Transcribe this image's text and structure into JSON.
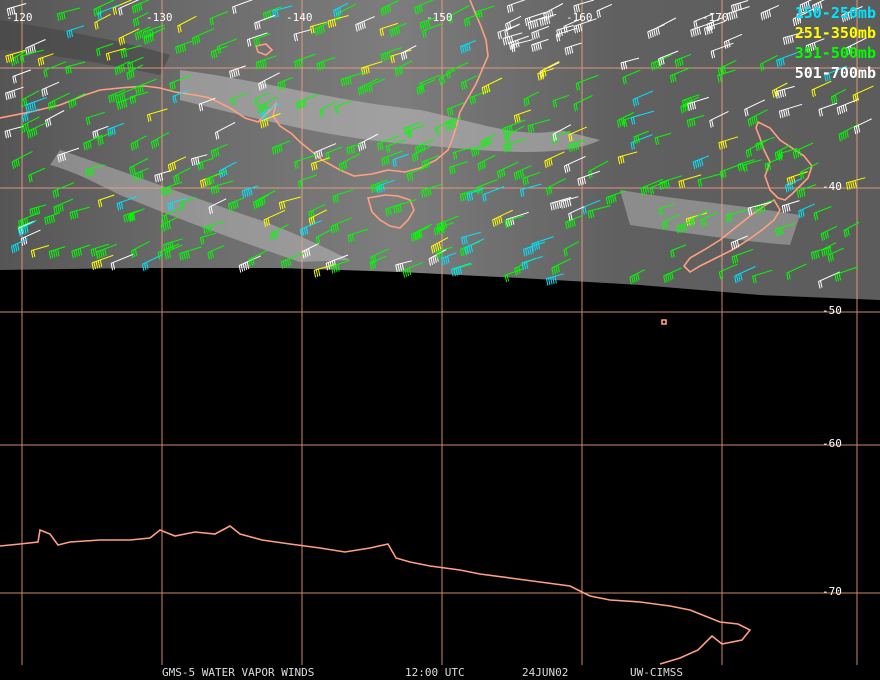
{
  "footer": {
    "product": "GMS-5 WATER VAPOR WINDS",
    "time": "12:00 UTC",
    "date": "24JUN02",
    "source": "UW-CIMSS"
  },
  "legend": [
    {
      "label": "150-250mb",
      "color": "#00e5ff"
    },
    {
      "label": "251-350mb",
      "color": "#ffff00"
    },
    {
      "label": "351-500mb",
      "color": "#00ff00"
    },
    {
      "label": "501-700mb",
      "color": "#ffffff"
    }
  ],
  "grid": {
    "line_color": "#f0a080",
    "longitude_labels": [
      "-120",
      "-130",
      "-140",
      "-150",
      "-160",
      "-170"
    ],
    "latitude_labels": [
      "-40",
      "-50",
      "-60",
      "-70"
    ]
  },
  "colors": {
    "coastline": "#ffa080",
    "background": "#000000"
  }
}
